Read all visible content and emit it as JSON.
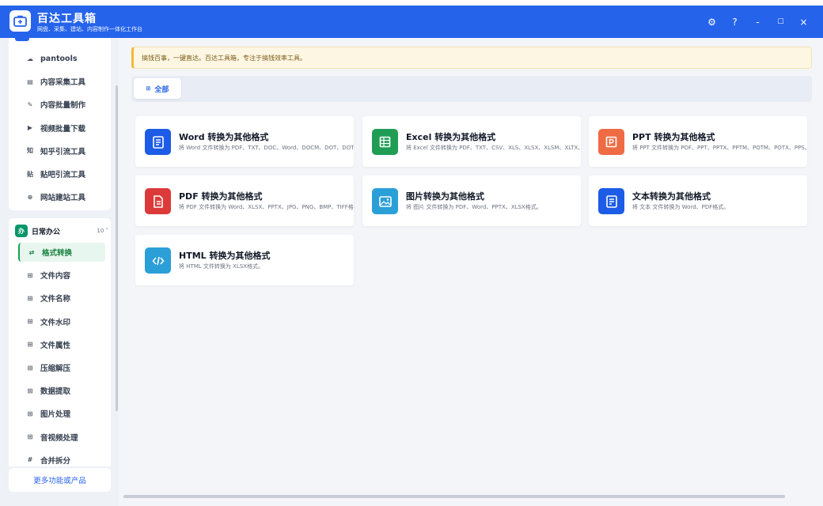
{
  "app": {
    "title": "百达工具箱",
    "subtitle": "网盘、采集、建站、内容制作一体化工作台"
  },
  "window_controls": [
    "⚙",
    "?",
    "-",
    "☐",
    "×"
  ],
  "sidebar": {
    "group1_items": [
      {
        "icon": "cloud-icon",
        "glyph": "☁",
        "label": "pantools"
      },
      {
        "icon": "collect-icon",
        "glyph": "▤",
        "label": "内容采集工具"
      },
      {
        "icon": "edit-icon",
        "glyph": "✎",
        "label": "内容批量制作"
      },
      {
        "icon": "video-icon",
        "glyph": "▶",
        "label": "视频批量下载"
      },
      {
        "icon": "zhihu-icon",
        "glyph": "知",
        "label": "知乎引流工具"
      },
      {
        "icon": "tieba-icon",
        "glyph": "贴",
        "label": "贴吧引流工具"
      },
      {
        "icon": "web-icon",
        "glyph": "⊕",
        "label": "网站建站工具"
      }
    ],
    "group2": {
      "title": "日常办公",
      "badge": "办",
      "count": "10 ˄",
      "items": [
        {
          "icon": "exchange-icon",
          "glyph": "⇄",
          "label": "格式转换",
          "active": true
        },
        {
          "icon": "grid-icon",
          "glyph": "⊞",
          "label": "文件内容"
        },
        {
          "icon": "grid-icon",
          "glyph": "⊞",
          "label": "文件名称"
        },
        {
          "icon": "grid-icon",
          "glyph": "⊞",
          "label": "文件水印"
        },
        {
          "icon": "grid-icon",
          "glyph": "⊞",
          "label": "文件属性"
        },
        {
          "icon": "grid-icon",
          "glyph": "⊞",
          "label": "压缩解压"
        },
        {
          "icon": "grid-icon",
          "glyph": "⊞",
          "label": "数据提取"
        },
        {
          "icon": "grid-icon",
          "glyph": "⊞",
          "label": "图片处理"
        },
        {
          "icon": "grid-icon",
          "glyph": "⊞",
          "label": "音视频处理"
        },
        {
          "icon": "hash-icon",
          "glyph": "#",
          "label": "合并拆分"
        }
      ]
    },
    "more_label": "更多功能或产品"
  },
  "notice": "搞钱百事，一键直达。百达工具箱，专注于搞钱效率工具。",
  "tabs": [
    {
      "label": "全部",
      "glyph": "⊞"
    }
  ],
  "cards": [
    {
      "title": "Word 转换为其他格式",
      "desc": "将 Word 文件转换为 PDF、TXT、DOC、Word、DOCM、DOT、DOTX",
      "color": "#1d5ce6",
      "icon": "word-doc-icon"
    },
    {
      "title": "Excel 转换为其他格式",
      "desc": "将 Excel 文件转换为 PDF、TXT、CSV、XLS、XLSX、XLSM、XLTX、X",
      "color": "#1f9d55",
      "icon": "excel-sheet-icon"
    },
    {
      "title": "PPT 转换为其他格式",
      "desc": "将 PPT 文件转换为 PDF、PPT、PPTX、PPTM、POTM、POTX、PPS、PP",
      "color": "#ef6b43",
      "icon": "ppt-slide-icon"
    },
    {
      "title": "PDF 转换为其他格式",
      "desc": "将 PDF 文件转换为 Word、XLSX、PPTX、JPG、PNG、BMP、TIFF格式",
      "color": "#dc3a3a",
      "icon": "pdf-file-icon"
    },
    {
      "title": "图片转换为其他格式",
      "desc": "将 图片 文件转换为 PDF、Word、PPTX、XLSX格式。",
      "color": "#2b9fd8",
      "icon": "image-icon"
    },
    {
      "title": "文本转换为其他格式",
      "desc": "将 文本 文件转换为 Word、PDF格式。",
      "color": "#1d5ce6",
      "icon": "text-file-icon"
    },
    {
      "title": "HTML 转换为其他格式",
      "desc": "将 HTML 文件转换为 XLSX格式。",
      "color": "#2b9fd8",
      "icon": "code-icon"
    }
  ]
}
